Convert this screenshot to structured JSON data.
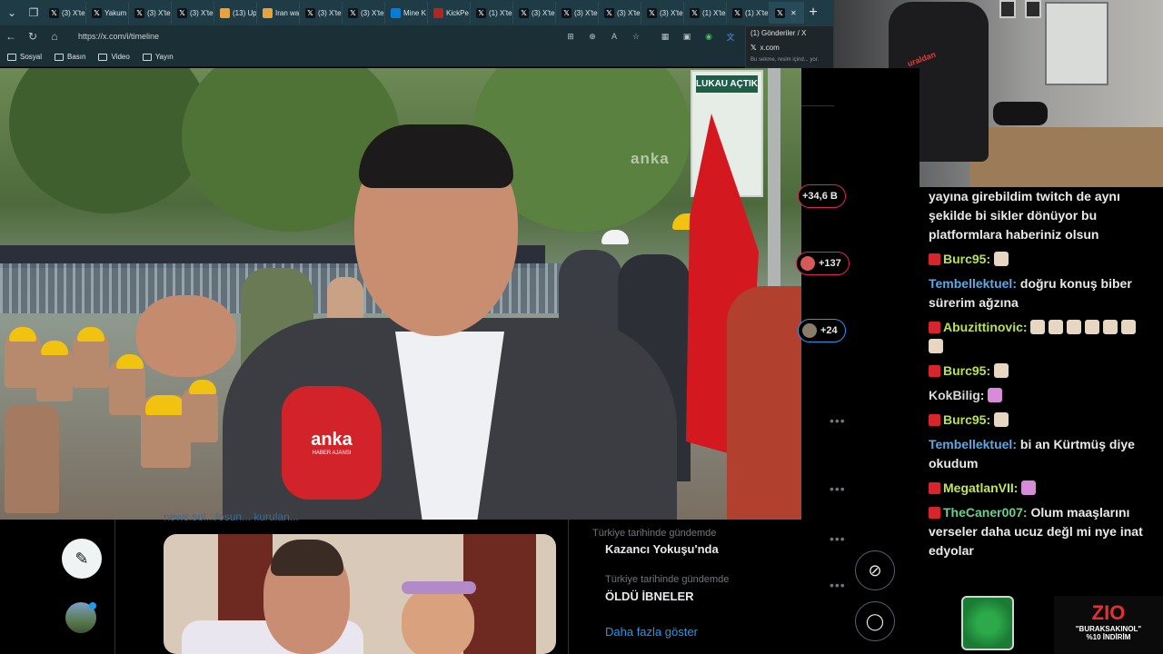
{
  "browser": {
    "tabs": [
      {
        "label": "(3) X'te",
        "icon": "x-icon"
      },
      {
        "label": "Yakum",
        "icon": "x-icon"
      },
      {
        "label": "(3) X'te",
        "icon": "x-icon"
      },
      {
        "label": "(3) X'te",
        "icon": "x-icon"
      },
      {
        "label": "(13) Up",
        "icon": "orange-icon"
      },
      {
        "label": "Iran wa",
        "icon": "orange-icon"
      },
      {
        "label": "(3) X'te",
        "icon": "x-icon"
      },
      {
        "label": "(3) X'te",
        "icon": "x-icon"
      },
      {
        "label": "Mine K",
        "icon": "blue-icon"
      },
      {
        "label": "KickPe",
        "icon": "red-icon"
      },
      {
        "label": "(1) X'te",
        "icon": "x-icon"
      },
      {
        "label": "(3) X'te",
        "icon": "x-icon"
      },
      {
        "label": "(3) X'te",
        "icon": "x-icon"
      },
      {
        "label": "(3) X'te",
        "icon": "x-icon"
      },
      {
        "label": "(3) X'te",
        "icon": "x-icon"
      },
      {
        "label": "(1) X'te",
        "icon": "x-icon"
      },
      {
        "label": "(1) X'te",
        "icon": "x-icon"
      },
      {
        "label": "",
        "icon": "x-icon"
      }
    ],
    "url": "https://x.com/i/timeline",
    "bookmarks": [
      "Sosyal",
      "Basın",
      "Video",
      "Yayın"
    ],
    "tooltip": {
      "title": "(1) Gönderiler / X",
      "site": "x.com",
      "note": "Bu sekme, resim içind... yor."
    }
  },
  "video": {
    "watermark": "anka",
    "mic_label": "anka",
    "mic_sub": "HABER AJANSI",
    "banner_text": "LUKAU AÇTIK"
  },
  "webcam": {
    "chair_logo": "uraldan"
  },
  "x": {
    "post_link": "news.sol.../osun... kurulan...",
    "pills": [
      "+34,6 B",
      "+137",
      "+24"
    ],
    "trends": [
      {
        "meta": "Türkiye tarihinde gündemde",
        "name": "Kazancı Yokuşu'nda"
      },
      {
        "meta": "Türkiye tarihinde gündemde",
        "name": "ÖLDÜ İBNELER"
      }
    ],
    "show_more": "Daha fazla göster"
  },
  "chat": {
    "messages": [
      {
        "user": "",
        "user_color": "#e9e9e9",
        "text": "yayına girebildim twitch de aynı şekilde bi sikler dönüyor bu platformlara haberiniz olsun"
      },
      {
        "user": "Burc95:",
        "user_color": "#b9e24a",
        "text": ""
      },
      {
        "user": "Tembellektuel:",
        "user_color": "#5aa9e6",
        "text": "doğru konuş biber sürerim ağzına"
      },
      {
        "user": "Abuzittinovic:",
        "user_color": "#b9e24a",
        "text": ""
      },
      {
        "user": "Burc95:",
        "user_color": "#b9e24a",
        "text": ""
      },
      {
        "user": "KokBilig:",
        "user_color": "#d8d8d8",
        "text": ""
      },
      {
        "user": "Burc95:",
        "user_color": "#b9e24a",
        "text": ""
      },
      {
        "user": "Tembellektuel:",
        "user_color": "#5aa9e6",
        "text": "bi an Kürtmüş diye okudum"
      },
      {
        "user": "MegatlanVII:",
        "user_color": "#c3e84a",
        "text": ""
      },
      {
        "user": "TheCaner007:",
        "user_color": "#6fce8f",
        "text": "Olum maaşlarını verseler daha ucuz değl mi nye inat edyolar"
      }
    ]
  },
  "promo": {
    "logo": "ZIO",
    "code": "\"BURAKSAKINOL\"",
    "discount": "%10 İNDİRİM"
  }
}
